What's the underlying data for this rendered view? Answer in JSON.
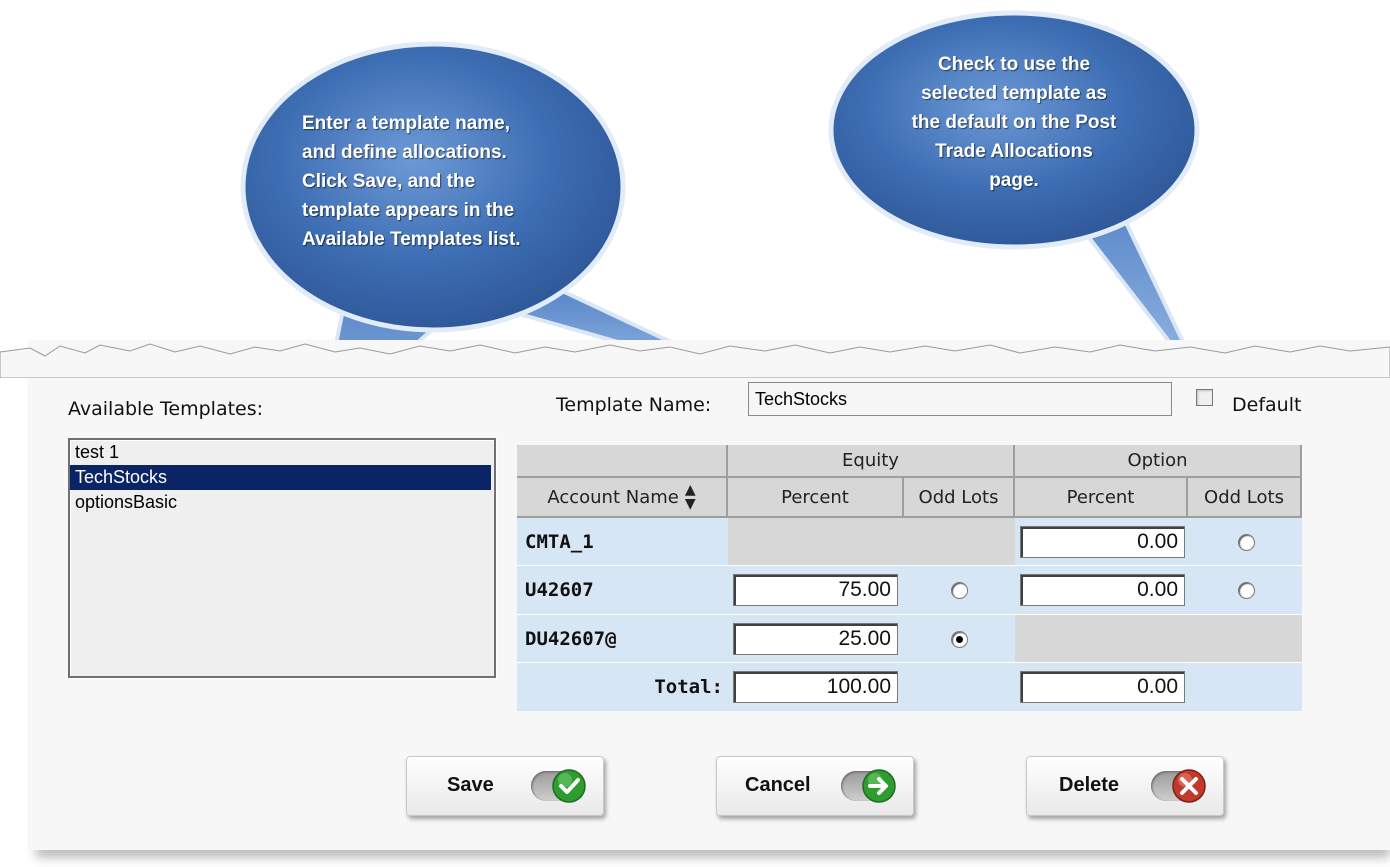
{
  "callouts": {
    "left": [
      "Enter a template name,",
      "and define allocations.",
      "Click Save, and the",
      "template appears in the",
      "Available Templates list."
    ],
    "right": [
      "Check to use the",
      "selected template as",
      "the default on the Post",
      "Trade Allocations",
      "page."
    ]
  },
  "templates": {
    "label": "Available Templates:",
    "items": [
      "test 1",
      "TechStocks",
      "optionsBasic"
    ],
    "selected": "TechStocks"
  },
  "form": {
    "name_label": "Template Name:",
    "name_value": "TechStocks",
    "default_label": "Default",
    "default_checked": false
  },
  "table": {
    "group_headers": [
      "Equity",
      "Option"
    ],
    "columns": [
      "Account Name",
      "Percent",
      "Odd Lots",
      "Percent",
      "Odd Lots"
    ],
    "sort_icon": "sort-arrows-icon",
    "rows": [
      {
        "account": "CMTA_1",
        "equity_percent": null,
        "equity_odd": null,
        "option_percent": "0.00",
        "option_odd": false
      },
      {
        "account": "U42607",
        "equity_percent": "75.00",
        "equity_odd": false,
        "option_percent": "0.00",
        "option_odd": false
      },
      {
        "account": "DU42607@",
        "equity_percent": "25.00",
        "equity_odd": true,
        "option_percent": null,
        "option_odd": null
      }
    ],
    "total_label": "Total:",
    "total_equity": "100.00",
    "total_option": "0.00"
  },
  "buttons": {
    "save": "Save",
    "cancel": "Cancel",
    "delete": "Delete"
  },
  "colors": {
    "callout": "#3f6fb5",
    "row_blue": "#d6e6f5",
    "selected": "#0b2466",
    "save_icon": "#2e9c2e",
    "cancel_icon": "#2e9c2e",
    "delete_icon": "#c0392b"
  }
}
